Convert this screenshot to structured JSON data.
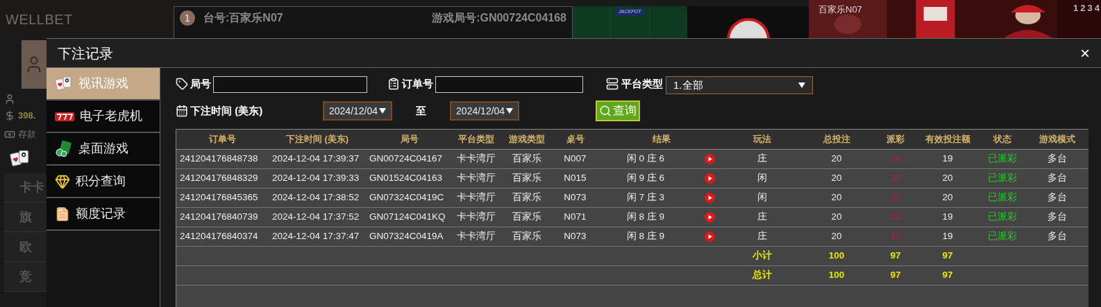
{
  "background": {
    "logo": "WELLBET",
    "table_no_badge": "1",
    "table_label": "台号:百家乐N07",
    "round_label": "游戏局号:GN00724C04168",
    "jackpot": "JACKPOT",
    "video_label": "百家乐N07",
    "road_tabs": [
      "1",
      "2",
      "3",
      "4"
    ],
    "balance": "398.",
    "side_links": [
      "存款"
    ],
    "side_menu": [
      "卡卡",
      "旗",
      "欧",
      "竞"
    ]
  },
  "dialog": {
    "title": "下注记录",
    "close": "×"
  },
  "menu": [
    {
      "label": "视讯游戏",
      "kind": "cards",
      "selected": true
    },
    {
      "label": "电子老虎机",
      "kind": "slots",
      "selected": false
    },
    {
      "label": "桌面游戏",
      "kind": "chips",
      "selected": false
    },
    {
      "label": "积分查询",
      "kind": "gem",
      "selected": false
    },
    {
      "label": "额度记录",
      "kind": "document",
      "selected": false
    }
  ],
  "filters": {
    "round_label": "局号",
    "order_label": "订单号",
    "platform_label": "平台类型",
    "platform_value": "1.全部",
    "time_label": "下注时间 (美东)",
    "date_from": "2024/12/04",
    "to_label": "至",
    "date_to": "2024/12/04",
    "query_button": "查询"
  },
  "table": {
    "columns": [
      "订单号",
      "下注时间 (美东)",
      "局号",
      "平台类型",
      "游戏类型",
      "桌号",
      "结果",
      "玩法",
      "总投注",
      "派彩",
      "有效投注额",
      "状态",
      "游戏模式"
    ],
    "rows": [
      {
        "order": "241204176848738",
        "time": "2024-12-04 17:39:37",
        "round": "GN00724C04167",
        "platform": "卡卡湾厅",
        "game": "百家乐",
        "table": "N007",
        "result": "闲 0 庄 6",
        "play": "庄",
        "total_bet": "20",
        "payout": "19",
        "valid_bet": "19",
        "status": "已派彩",
        "mode": "多台"
      },
      {
        "order": "241204176848329",
        "time": "2024-12-04 17:39:33",
        "round": "GN01524C04163",
        "platform": "卡卡湾厅",
        "game": "百家乐",
        "table": "N015",
        "result": "闲 9 庄 6",
        "play": "闲",
        "total_bet": "20",
        "payout": "20",
        "valid_bet": "20",
        "status": "已派彩",
        "mode": "多台"
      },
      {
        "order": "241204176845365",
        "time": "2024-12-04 17:38:52",
        "round": "GN07324C0419C",
        "platform": "卡卡湾厅",
        "game": "百家乐",
        "table": "N073",
        "result": "闲 7 庄 3",
        "play": "闲",
        "total_bet": "20",
        "payout": "20",
        "valid_bet": "20",
        "status": "已派彩",
        "mode": "多台"
      },
      {
        "order": "241204176840739",
        "time": "2024-12-04 17:37:52",
        "round": "GN07124C041KQ",
        "platform": "卡卡湾厅",
        "game": "百家乐",
        "table": "N071",
        "result": "闲 8 庄 9",
        "play": "庄",
        "total_bet": "20",
        "payout": "19",
        "valid_bet": "19",
        "status": "已派彩",
        "mode": "多台"
      },
      {
        "order": "241204176840374",
        "time": "2024-12-04 17:37:47",
        "round": "GN07324C0419A",
        "platform": "卡卡湾厅",
        "game": "百家乐",
        "table": "N073",
        "result": "闲 8 庄 9",
        "play": "庄",
        "total_bet": "20",
        "payout": "19",
        "valid_bet": "19",
        "status": "已派彩",
        "mode": "多台"
      }
    ],
    "summary": [
      {
        "label": "小计",
        "total_bet": "100",
        "payout": "97",
        "valid_bet": "97"
      },
      {
        "label": "总计",
        "total_bet": "100",
        "payout": "97",
        "valid_bet": "97"
      }
    ]
  }
}
